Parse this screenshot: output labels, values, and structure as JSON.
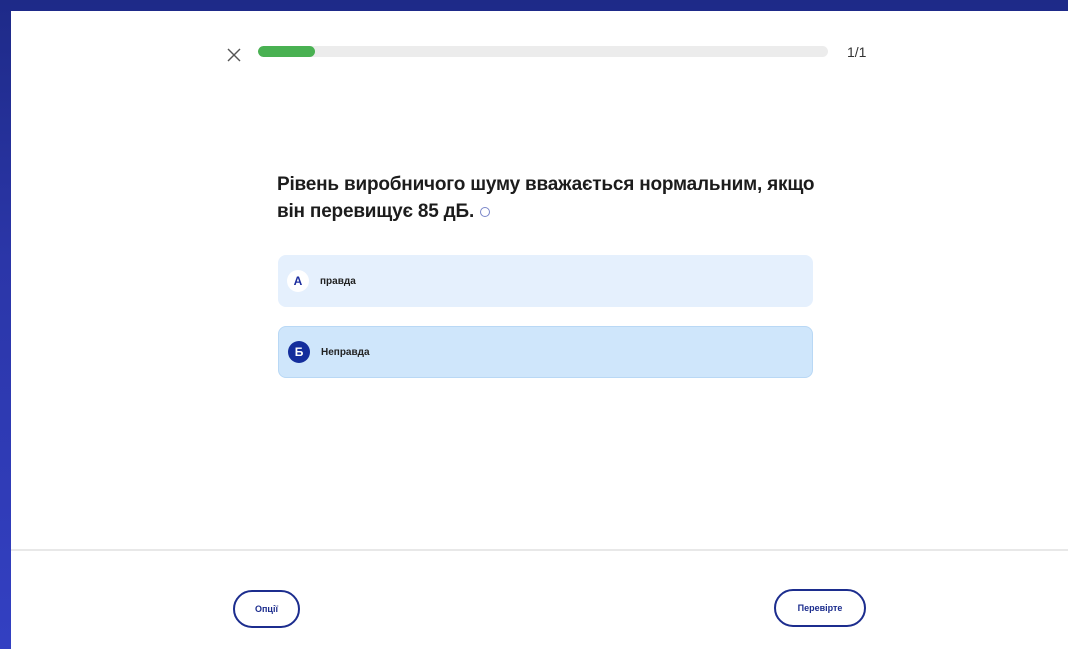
{
  "header": {
    "close_label": "X",
    "progress_fraction": 0.1,
    "progress_count": "1/1"
  },
  "question": {
    "text": "Рівень виробничого шуму вважається нормальним, якщо він перевищує 85 дБ."
  },
  "options": [
    {
      "letter": "А",
      "text": "правда",
      "selected": false
    },
    {
      "letter": "Б",
      "text": "Неправда",
      "selected": true
    }
  ],
  "footer": {
    "options_label": "Опції",
    "check_label": "Перевірте"
  },
  "colors": {
    "background": "#2b36a8",
    "progress_fill": "#49b152",
    "accent": "#1c2d8e",
    "option_bg": "#e5f0fd",
    "option_selected_bg": "#cfe6fb"
  },
  "icons": {
    "close": "close-icon",
    "hint": "hint-icon"
  }
}
